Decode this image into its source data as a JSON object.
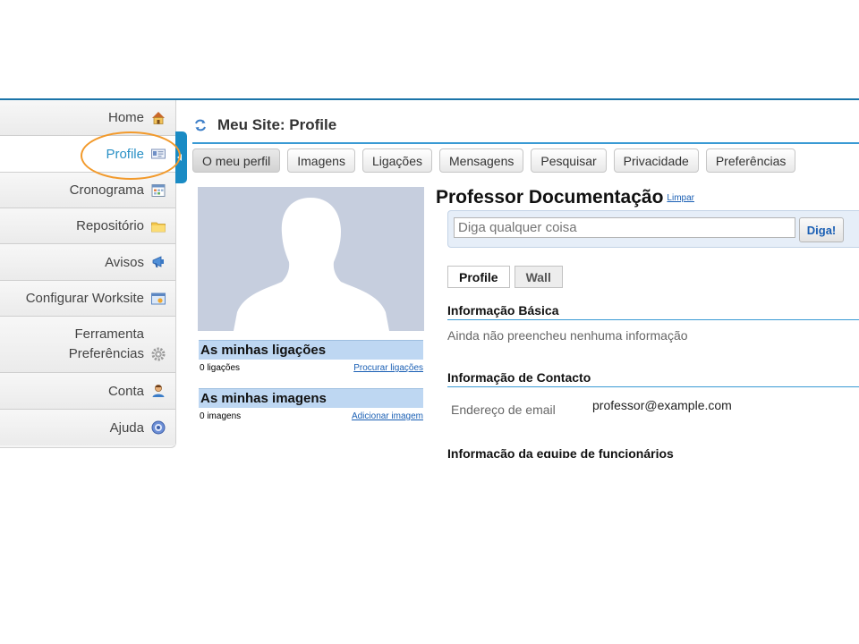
{
  "page": {
    "title": "Meu Site: Profile"
  },
  "sidebar": {
    "items": [
      {
        "label": "Home",
        "icon": "home-icon"
      },
      {
        "label": "Profile",
        "icon": "profile-card-icon"
      },
      {
        "label": "Cronograma",
        "icon": "calendar-icon"
      },
      {
        "label": "Repositório",
        "icon": "folder-icon"
      },
      {
        "label": "Avisos",
        "icon": "megaphone-icon"
      },
      {
        "label": "Configurar Worksite",
        "icon": "settings-window-icon"
      },
      {
        "label_line1": "Ferramenta",
        "label_line2": "Preferências",
        "icon": "gear-icon"
      },
      {
        "label": "Conta",
        "icon": "user-icon"
      },
      {
        "label": "Ajuda",
        "icon": "help-icon"
      }
    ],
    "active_index": 1
  },
  "nav": {
    "buttons": [
      "O meu perfil",
      "Imagens",
      "Ligações",
      "Mensagens",
      "Pesquisar",
      "Privacidade",
      "Preferências"
    ],
    "current_index": 0
  },
  "profile": {
    "name": "Professor Documentação",
    "clear_link": "Limpar",
    "status_placeholder": "Diga qualquer coisa",
    "status_button": "Diga!",
    "tabs": [
      "Profile",
      "Wall"
    ],
    "connections": {
      "heading": "As minhas ligações",
      "count": "0 ligações",
      "link": "Procurar ligações"
    },
    "images": {
      "heading": "As minhas imagens",
      "count": "0 imagens",
      "link": "Adicionar imagem"
    },
    "basic": {
      "heading": "Informação Básica",
      "text": "Ainda não preencheu nenhuma informação"
    },
    "contact": {
      "heading": "Informação de Contacto",
      "email_label": "Endereço de email",
      "email_value": "professor@example.com"
    },
    "staff": {
      "heading": "Informação da equipe de funcionários"
    }
  },
  "colors": {
    "accent": "#1a8bc4",
    "highlight": "#f29a2c",
    "link": "#1a5fb4"
  }
}
